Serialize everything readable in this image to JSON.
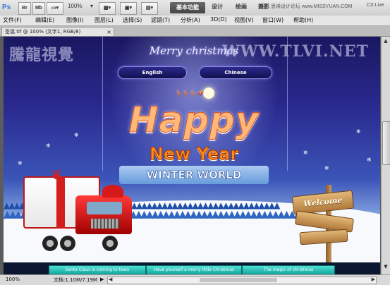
{
  "app": {
    "logo": "Ps",
    "toolbar": {
      "bridge_label": "Br",
      "minibridge_label": "Mb",
      "zoom": "100%",
      "workspaces": [
        "基本功能",
        "设计",
        "绘画",
        "摄影"
      ],
      "active_workspace": "基本功能",
      "cs_live": "CS Live",
      "watermark_logo": "思缘设计论坛 www.MISSYUAN.COM"
    },
    "menu": [
      "文件(F)",
      "编辑(E)",
      "图像(I)",
      "图层(L)",
      "选择(S)",
      "滤镜(T)",
      "分析(A)",
      "3D(D)",
      "视图(V)",
      "窗口(W)",
      "帮助(H)"
    ],
    "document_tab": "圣诞.tif @ 100% (文字1, RGB/8)",
    "status": {
      "zoom": "100%",
      "doc_size": "文档:1.10M/7.19M"
    }
  },
  "artwork": {
    "top_title": "Merry christmas",
    "watermark_left": "騰龍視覺",
    "watermark_right": "WWW.TLVI.NET",
    "buttons": [
      "English",
      "Chinese"
    ],
    "headline_happy": "Happy",
    "headline_new_year": "New Year",
    "headline_winter": "WINTER WORLD",
    "sign": "Welcome",
    "footer_links": [
      "Santa Claus is coming to town",
      "Have yourself a merry little Christmas",
      "The magic of christmas"
    ]
  }
}
